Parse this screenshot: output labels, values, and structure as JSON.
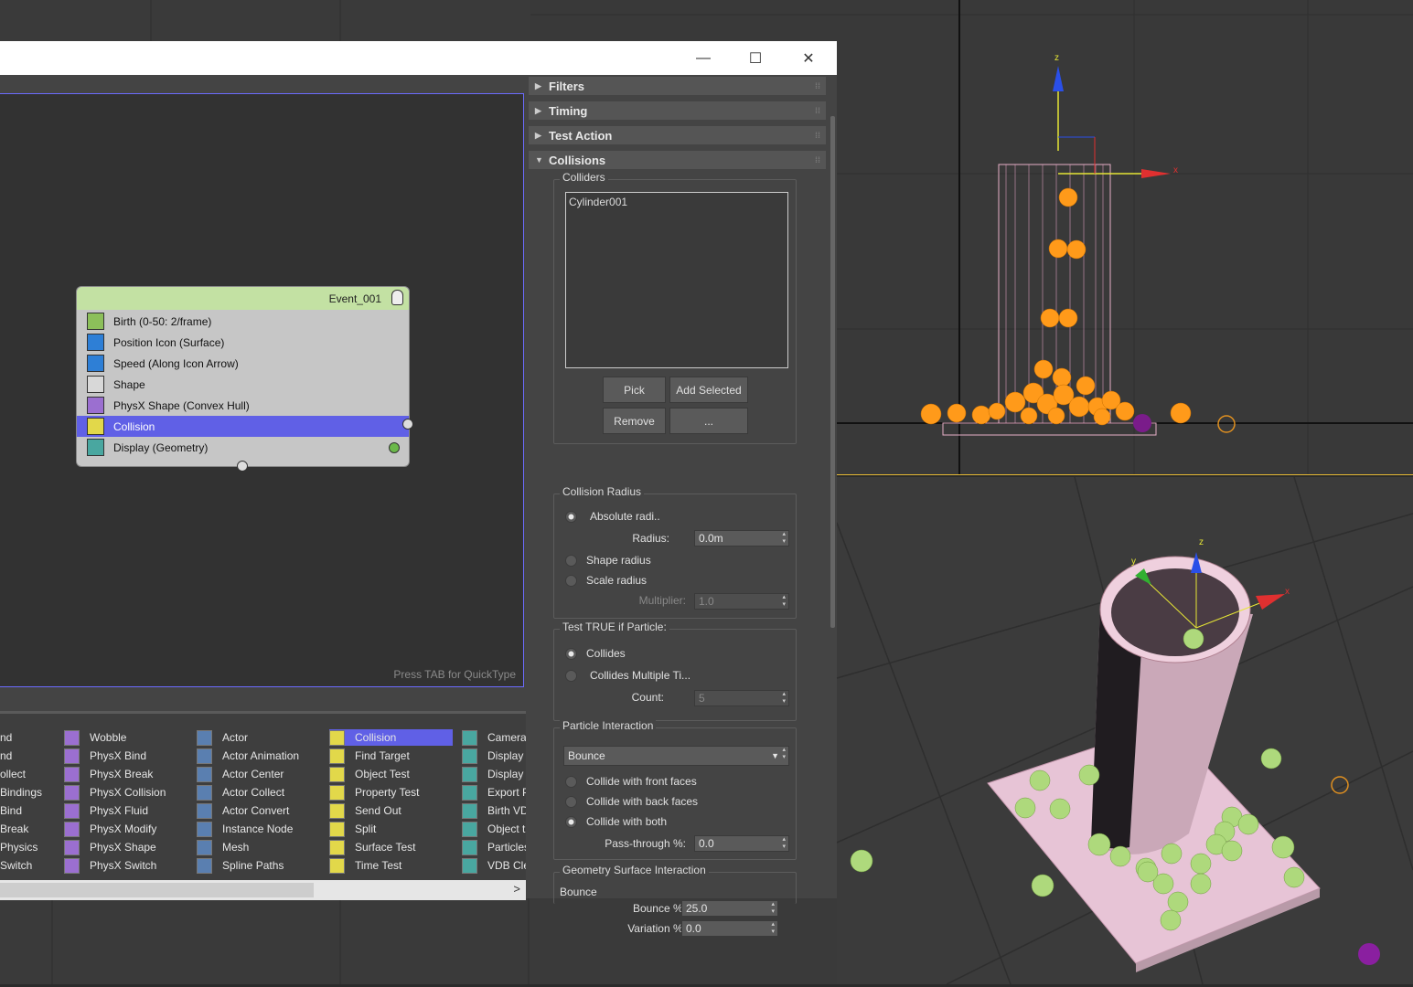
{
  "window": {
    "minimize": "—",
    "maximize": "☐",
    "close": "✕"
  },
  "event": {
    "title": "Event_001",
    "operators": [
      {
        "label": "Birth (0-50: 2/frame)",
        "icon": "birth-icon",
        "color": "#8cbf5a"
      },
      {
        "label": "Position Icon (Surface)",
        "icon": "position-icon",
        "color": "#2e7fd6"
      },
      {
        "label": "Speed (Along Icon Arrow)",
        "icon": "speed-icon",
        "color": "#2e7fd6"
      },
      {
        "label": "Shape",
        "icon": "shape-icon",
        "color": "#d8d8d8"
      },
      {
        "label": "PhysX Shape (Convex Hull)",
        "icon": "physx-shape-icon",
        "color": "#9b6fd0"
      },
      {
        "label": "Collision",
        "icon": "collision-icon",
        "color": "#e2d84a"
      },
      {
        "label": "Display (Geometry)",
        "icon": "display-icon",
        "color": "#49a7a0"
      }
    ]
  },
  "graph": {
    "hint": "Press TAB for QuickType"
  },
  "depot": {
    "columns": [
      [
        "nd",
        "nd",
        "ollect",
        "Bindings",
        "Bind",
        "Break",
        "Physics",
        "Switch"
      ],
      [
        "Wobble",
        "PhysX Bind",
        "PhysX Break",
        "PhysX Collision",
        "PhysX Fluid",
        "PhysX Modify",
        "PhysX Shape",
        "PhysX Switch"
      ],
      [
        "Actor",
        "Actor Animation",
        "Actor Center",
        "Actor Collect",
        "Actor Convert",
        "Instance Node",
        "Mesh",
        "Spline Paths"
      ],
      [
        "Collision",
        "Find Target",
        "Object Test",
        "Property Test",
        "Send Out",
        "Split",
        "Surface Test",
        "Time Test"
      ],
      [
        "Camera",
        "Display",
        "Display",
        "Export P",
        "Birth VD",
        "Object t",
        "Particles",
        "VDB Cle"
      ]
    ],
    "scroll_right": ">"
  },
  "rollouts": {
    "filters": "Filters",
    "timing": "Timing",
    "test_action": "Test Action",
    "collisions": "Collisions"
  },
  "colliders": {
    "title": "Colliders",
    "list": [
      "Cylinder001"
    ],
    "pick": "Pick",
    "add_selected": "Add Selected",
    "remove": "Remove",
    "more": "..."
  },
  "collision_radius": {
    "title": "Collision Radius",
    "absolute": "Absolute radi..",
    "radius_label": "Radius:",
    "radius_value": "0.0m",
    "shape_radius": "Shape radius",
    "scale_radius": "Scale radius",
    "multiplier_label": "Multiplier:",
    "multiplier_value": "1.0"
  },
  "test_true": {
    "title": "Test TRUE if Particle:",
    "collides": "Collides",
    "multiple": "Collides Multiple Ti...",
    "count_label": "Count:",
    "count_value": "5"
  },
  "particle_interaction": {
    "title": "Particle Interaction",
    "mode": "Bounce",
    "front": "Collide with front faces",
    "back": "Collide with back faces",
    "both": "Collide with both",
    "pass_label": "Pass-through %:",
    "pass_value": "0.0"
  },
  "geometry_surface": {
    "title": "Geometry Surface Interaction",
    "bounce_title": "Bounce",
    "bounce_label": "Bounce %:",
    "bounce_value": "25.0",
    "variation_label": "Variation %:",
    "variation_value": "0.0"
  },
  "viewport": {
    "axis_z": "z",
    "axis_x": "x",
    "axis_y": "y"
  },
  "colors": {
    "accent": "#6060e6",
    "event_header": "#c3e1a3",
    "particle_orange": "#ff9a1a",
    "particle_green": "#a8d878",
    "cylinder_pink": "#e8c8d8"
  }
}
